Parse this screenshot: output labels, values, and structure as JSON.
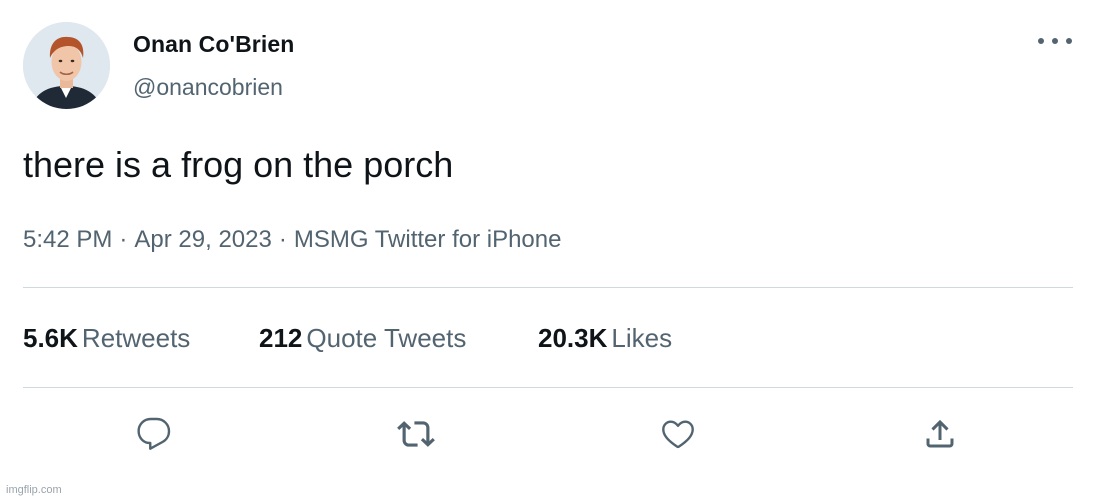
{
  "tweet": {
    "author": {
      "display_name": "Onan Co'Brien",
      "handle": "@onancobrien"
    },
    "text": "there is a frog on the porch",
    "meta": {
      "time": "5:42 PM",
      "separator": "·",
      "date": "Apr 29, 2023",
      "source": "MSMG Twitter for iPhone"
    },
    "stats": [
      {
        "value": "5.6K",
        "label": "Retweets"
      },
      {
        "value": "212",
        "label": "Quote Tweets"
      },
      {
        "value": "20.3K",
        "label": "Likes"
      }
    ],
    "actions": [
      {
        "icon": "reply-icon"
      },
      {
        "icon": "retweet-icon"
      },
      {
        "icon": "like-icon"
      },
      {
        "icon": "share-icon"
      }
    ],
    "more_icon": "more-options-icon"
  },
  "watermark": "imgflip.com",
  "colors": {
    "primary_text": "#0f1419",
    "secondary_text": "#536471",
    "divider": "#cfd9de",
    "background": "#ffffff"
  }
}
